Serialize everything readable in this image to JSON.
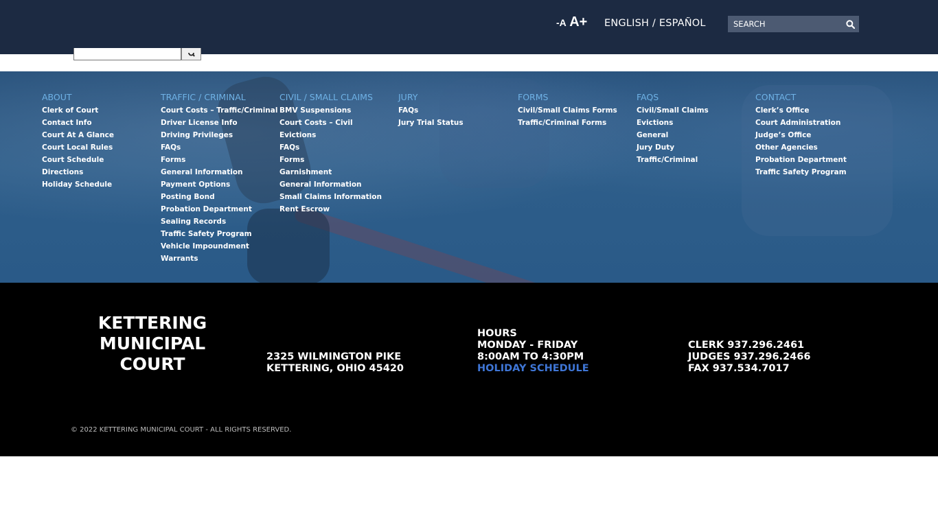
{
  "header": {
    "font_decrease": "-A",
    "font_increase": "A+",
    "language_english": "ENGLISH",
    "language_separator": " / ",
    "language_spanish": "ESPAÑOL",
    "search_placeholder": "SEARCH",
    "search_icon": "magnifier-icon"
  },
  "nav": {
    "columns": [
      {
        "heading": "ABOUT",
        "links": [
          "Clerk of Court",
          "Contact Info",
          "Court At A Glance",
          "Court Local Rules",
          "Court Schedule",
          "Directions",
          "Holiday Schedule"
        ]
      },
      {
        "heading": "TRAFFIC / CRIMINAL",
        "links": [
          "Court Costs – Traffic/Criminal",
          "Driver License Info",
          "Driving Privileges",
          "FAQs",
          "Forms",
          "General Information",
          "Payment Options",
          "Posting Bond",
          "Probation Department",
          "Sealing Records",
          "Traffic Safety Program",
          "Vehicle Impoundment",
          "Warrants"
        ]
      },
      {
        "heading": "CIVIL / SMALL CLAIMS",
        "links": [
          "BMV Suspensions",
          "Court Costs – Civil",
          "Evictions",
          "FAQs",
          "Forms",
          "Garnishment",
          "General Information",
          "Small Claims Information",
          "Rent Escrow"
        ]
      },
      {
        "heading": "JURY",
        "links": [
          "FAQs",
          "Jury Trial Status"
        ]
      },
      {
        "heading": "FORMS",
        "links": [
          "Civil/Small Claims Forms",
          "Traffic/Criminal Forms"
        ]
      },
      {
        "heading": "FAQS",
        "links": [
          "Civil/Small Claims",
          "Evictions",
          "General",
          "Jury Duty",
          "Traffic/Criminal"
        ]
      },
      {
        "heading": "CONTACT",
        "links": [
          "Clerk’s Office",
          "Court Administration",
          "Judge’s Office",
          "Other Agencies",
          "Probation Department",
          "Traffic Safety Program"
        ]
      }
    ]
  },
  "footer": {
    "court_name": [
      "KETTERING",
      "MUNICIPAL",
      "COURT"
    ],
    "address": [
      "2325 WILMINGTON PIKE",
      "KETTERING, OHIO 45420"
    ],
    "hours_title": "HOURS",
    "hours_days": "MONDAY - FRIDAY",
    "hours_time": "8:00AM TO 4:30PM",
    "holiday_link": "HOLIDAY SCHEDULE",
    "phones": [
      "CLERK 937.296.2461",
      "JUDGES 937.296.2466",
      "FAX 937.534.7017"
    ],
    "copyright": "© 2022 KETTERING MUNICIPAL COURT - ALL RIGHTS RESERVED."
  },
  "colors": {
    "header_bg": "#1c2a42",
    "nav_heading": "#6fb2e6",
    "footer_bg": "#000000",
    "link_accent": "#3f76d6"
  }
}
